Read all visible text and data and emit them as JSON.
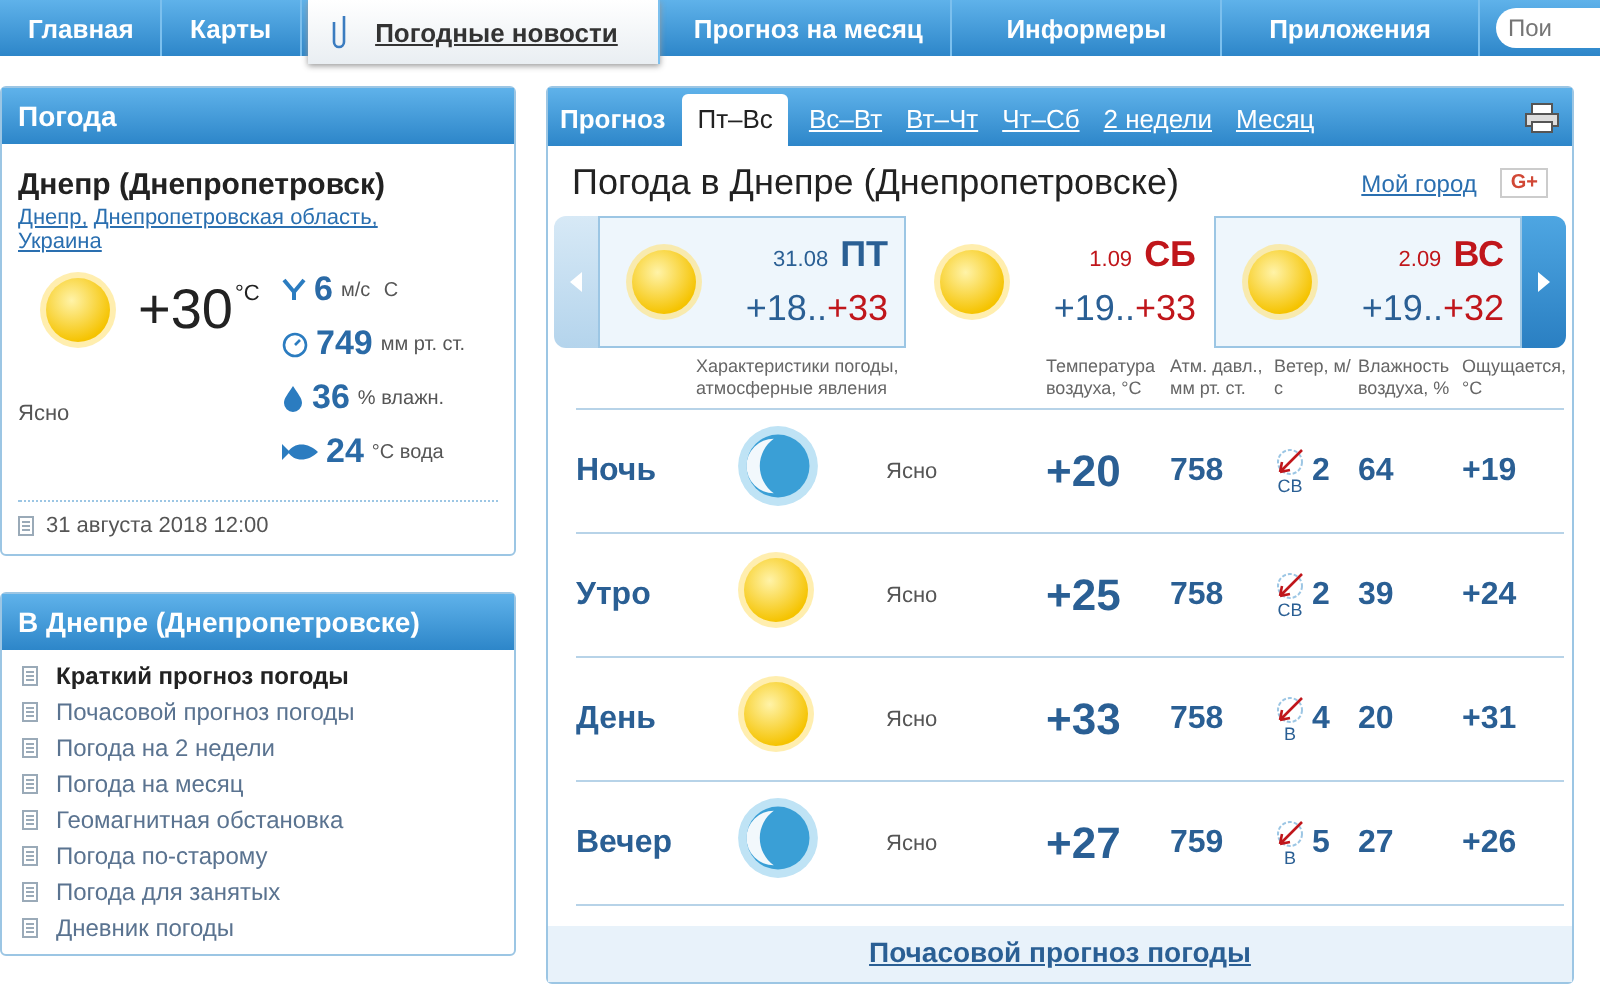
{
  "nav": {
    "items": [
      {
        "label": "Главная",
        "selected": false
      },
      {
        "label": "Карты",
        "selected": false
      },
      {
        "label": "Погодные новости",
        "selected": true
      },
      {
        "label": "Прогноз на месяц",
        "selected": false
      },
      {
        "label": "Информеры",
        "selected": false
      },
      {
        "label": "Приложения",
        "selected": false
      }
    ],
    "search": {
      "placeholder": "Пои"
    }
  },
  "current": {
    "title": "Погода",
    "city": "Днепр (Днепропетровск)",
    "links": [
      "Днепр,",
      "Днепропетровская область,",
      "Украина"
    ],
    "temperature": "+30",
    "temp_unit": "°C",
    "condition": "Ясно",
    "stats": [
      {
        "kind": "wind",
        "value": "6",
        "unit": "м/с",
        "direction": "С"
      },
      {
        "kind": "pressure",
        "value": "749",
        "unit": "мм рт. ст."
      },
      {
        "kind": "humidity",
        "value": "36",
        "unit": "% влажн."
      },
      {
        "kind": "water",
        "value": "24",
        "unit": "°C вода"
      }
    ],
    "updated": "31 августа 2018 12:00"
  },
  "city_menu": {
    "title": "В Днепре (Днепропетровске)",
    "items": [
      {
        "label": "Краткий прогноз погоды",
        "selected": true
      },
      {
        "label": "Почасовой прогноз погоды",
        "selected": false
      },
      {
        "label": "Погода на 2 недели",
        "selected": false
      },
      {
        "label": "Погода на месяц",
        "selected": false
      },
      {
        "label": "Геомагнитная обстановка",
        "selected": false
      },
      {
        "label": "Погода по-старому",
        "selected": false
      },
      {
        "label": "Погода для занятых",
        "selected": false
      },
      {
        "label": "Дневник погоды",
        "selected": false
      }
    ]
  },
  "forecast": {
    "label": "Прогноз",
    "tabs": [
      {
        "label": "Пт–Вс",
        "selected": true
      },
      {
        "label": "Вс–Вт",
        "selected": false
      },
      {
        "label": "Вт–Чт",
        "selected": false
      },
      {
        "label": "Чт–Сб",
        "selected": false
      },
      {
        "label": "2 недели",
        "selected": false
      },
      {
        "label": "Месяц",
        "selected": false
      }
    ],
    "title": "Погода в Днепре (Днепропетровске)",
    "my_city": "Мой город",
    "share": "G+",
    "days": [
      {
        "date": "31.08",
        "weekday": "ПТ",
        "kind": "weekday",
        "highlighted": true,
        "min": "+18..",
        "max": "+33"
      },
      {
        "date": "1.09",
        "weekday": "СБ",
        "kind": "weekend",
        "highlighted": false,
        "min": "+19..",
        "max": "+33"
      },
      {
        "date": "2.09",
        "weekday": "ВС",
        "kind": "weekend",
        "highlighted": true,
        "min": "+19..",
        "max": "+32"
      }
    ],
    "columns": [
      "Характеристики погоды, атмосферные явления",
      "Температура воздуха, °C",
      "Атм. давл., мм рт. ст.",
      "Ветер, м/с",
      "Влажность воздуха, %",
      "Ощущается, °C"
    ],
    "rows": [
      {
        "period": "Ночь",
        "kind": "night",
        "condition": "Ясно",
        "temperature": "+20",
        "pressure": "758",
        "wind": "2",
        "wind_dir": "СВ",
        "humidity": "64",
        "feels": "+19"
      },
      {
        "period": "Утро",
        "kind": "day",
        "condition": "Ясно",
        "temperature": "+25",
        "pressure": "758",
        "wind": "2",
        "wind_dir": "СВ",
        "humidity": "39",
        "feels": "+24"
      },
      {
        "period": "День",
        "kind": "day",
        "condition": "Ясно",
        "temperature": "+33",
        "pressure": "758",
        "wind": "4",
        "wind_dir": "В",
        "humidity": "20",
        "feels": "+31"
      },
      {
        "period": "Вечер",
        "kind": "night",
        "condition": "Ясно",
        "temperature": "+27",
        "pressure": "759",
        "wind": "5",
        "wind_dir": "В",
        "humidity": "27",
        "feels": "+26"
      }
    ],
    "hourly_link": "Почасовой прогноз погоды"
  }
}
